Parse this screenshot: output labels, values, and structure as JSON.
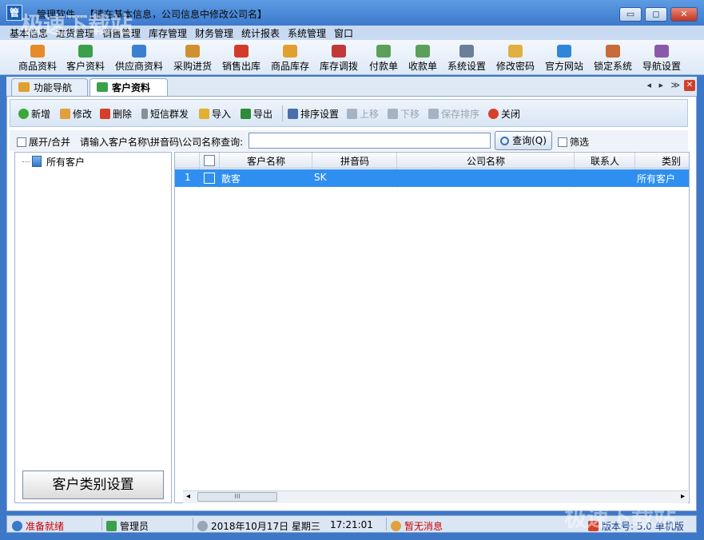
{
  "window": {
    "icon_text": "管",
    "title": "…管理软件…【请在基本信息，公司信息中修改公司名】",
    "minimize": "▭",
    "maximize": "◻",
    "close": "✕"
  },
  "menu": [
    "基本信息",
    "进货管理",
    "销售管理",
    "库存管理",
    "财务管理",
    "统计报表",
    "系统管理",
    "窗口"
  ],
  "toolbar": [
    {
      "label": "商品资料",
      "icon": "goods-icon",
      "color": "#e58b2a"
    },
    {
      "label": "客户资料",
      "icon": "customer-icon",
      "color": "#3aa04a"
    },
    {
      "label": "供应商资料",
      "icon": "supplier-icon",
      "color": "#3b7fd0"
    },
    {
      "label": "采购进货",
      "icon": "truck-icon",
      "color": "#d09030"
    },
    {
      "label": "销售出库",
      "icon": "basket-icon",
      "color": "#d23a2a"
    },
    {
      "label": "商品库存",
      "icon": "stock-icon",
      "color": "#e0a030"
    },
    {
      "label": "库存调拨",
      "icon": "transfer-icon",
      "color": "#c03a3a"
    },
    {
      "label": "付款单",
      "icon": "payment-icon",
      "color": "#5aa05a"
    },
    {
      "label": "收款单",
      "icon": "receipt-icon",
      "color": "#5aa05a"
    },
    {
      "label": "系统设置",
      "icon": "settings-icon",
      "color": "#6c7f9a"
    },
    {
      "label": "修改密码",
      "icon": "pencil-icon",
      "color": "#e0b040"
    },
    {
      "label": "官方网站",
      "icon": "ie-icon",
      "color": "#2f86d8"
    },
    {
      "label": "锁定系统",
      "icon": "lock-icon",
      "color": "#c86a3a"
    },
    {
      "label": "导航设置",
      "icon": "nav-icon",
      "color": "#8a5aa8"
    }
  ],
  "tabs": [
    {
      "label": "功能导航",
      "icon": "nav-tab-icon"
    },
    {
      "label": "客户资料",
      "icon": "customer-tab-icon"
    }
  ],
  "tab_controls": "◂ ▸ ≫",
  "tab_close": "✕",
  "actions": [
    {
      "label": "新增",
      "icon": "add-icon",
      "color": "#3aa83a",
      "disabled": false
    },
    {
      "label": "修改",
      "icon": "edit-icon",
      "color": "#e0a040",
      "disabled": false
    },
    {
      "label": "删除",
      "icon": "delete-icon",
      "color": "#d6402a",
      "disabled": false
    },
    {
      "label": "短信群发",
      "icon": "sms-icon",
      "color": "#8a8f96",
      "disabled": false
    },
    {
      "label": "导入",
      "icon": "import-icon",
      "color": "#e0b030",
      "disabled": false
    },
    {
      "label": "导出",
      "icon": "excel-icon",
      "color": "#2f8a3a",
      "disabled": false
    },
    {
      "label": "排序设置",
      "icon": "sort-icon",
      "color": "#4a6fa8",
      "disabled": false
    },
    {
      "label": "上移",
      "icon": "move-up-icon",
      "color": "#a5b3c2",
      "disabled": true
    },
    {
      "label": "下移",
      "icon": "move-down-icon",
      "color": "#a5b3c2",
      "disabled": true
    },
    {
      "label": "保存排序",
      "icon": "save-icon",
      "color": "#a5b3c2",
      "disabled": true
    },
    {
      "label": "关闭",
      "icon": "close-icon",
      "color": "#d6402a",
      "disabled": false
    }
  ],
  "search": {
    "expand_label": "展开/合并",
    "prompt": "请输入客户名称\\拼音码\\公司名称查询:",
    "value": "",
    "query_label": "查询(Q)",
    "filter_label": "筛选"
  },
  "tree": {
    "root": "所有客户"
  },
  "category_button": "客户类别设置",
  "grid": {
    "columns": [
      "客户名称",
      "拼音码",
      "公司名称",
      "联系人",
      "类别"
    ],
    "rows": [
      {
        "index": "1",
        "name": "散客",
        "pinyin": "SK",
        "company": "",
        "contact": "",
        "category": "所有客户"
      }
    ],
    "scroll_left": "◂",
    "scroll_right": "▸",
    "thumb_grip": "III"
  },
  "status": {
    "ready": "准备就绪",
    "user": "管理员",
    "date": "2018年10月17日 星期三",
    "time": "17:21:01",
    "message": "暂无消息",
    "version": "版本号: 5.0 单机版"
  },
  "watermark": "极速下载站",
  "colors": {
    "accent": "#2f8ff0",
    "status_red": "#cc0000",
    "frame_blue": "#3d78c8"
  }
}
